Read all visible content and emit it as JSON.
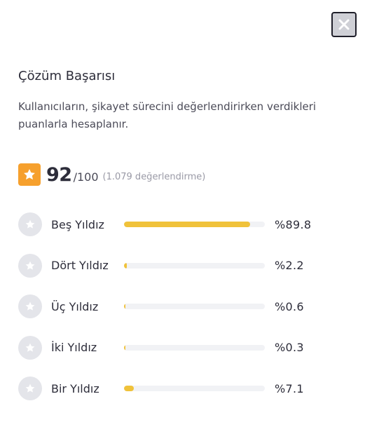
{
  "modal": {
    "title": "Çözüm Başarısı",
    "description": "Kullanıcıların, şikayet sürecini değerlendirirken verdikleri puanlarla hesaplanır.",
    "close_icon": "close-icon"
  },
  "score": {
    "icon": "star-icon",
    "value": "92",
    "max": "/100",
    "count": "(1.079 değerlendirme)"
  },
  "ratings": [
    {
      "label": "Beş Yıldız",
      "percent_text": "%89.8",
      "percent": 89.8
    },
    {
      "label": "Dört Yıldız",
      "percent_text": "%2.2",
      "percent": 2.2
    },
    {
      "label": "Üç Yıldız",
      "percent_text": "%0.6",
      "percent": 0.6
    },
    {
      "label": "İki Yıldız",
      "percent_text": "%0.3",
      "percent": 0.3
    },
    {
      "label": "Bir Yıldız",
      "percent_text": "%7.1",
      "percent": 7.1
    }
  ],
  "colors": {
    "accent": "#f6a02d",
    "bar_fill": "#f0c23a",
    "bar_track": "#f1f2f5",
    "rating_icon_bg": "#e4e5ea",
    "close_bg": "#cfd0d6"
  }
}
